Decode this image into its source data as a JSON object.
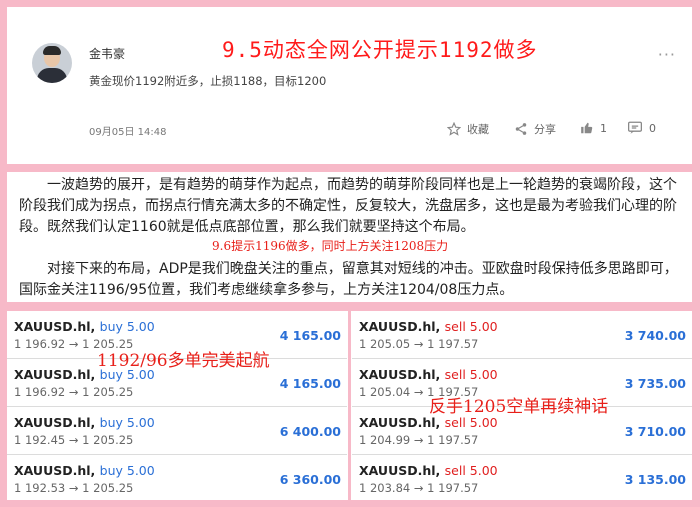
{
  "post": {
    "username": "金韦豪",
    "headline": "9.5动态全网公开提示1192做多",
    "summary": "黄金现价1192附近多，止损1188，目标1200",
    "date": "09月05日 14:48",
    "more": "···",
    "actions": {
      "favorite": "收藏",
      "share": "分享",
      "like_count": "1",
      "comment_count": "0"
    }
  },
  "article": {
    "paragraph1": "一波趋势的展开，是有趋势的萌芽作为起点，而趋势的萌芽阶段同样也是上一轮趋势的衰竭阶段，这个阶段我们成为拐点，而拐点行情充满太多的不确定性，反复较大，洗盘居多，这也是最为考验我们心理的阶段。既然我们认定1160就是低点底部位置，那么我们就要坚持这个布局。",
    "note": "9.6提示1196做多，同时上方关注1208压力",
    "paragraph2": "对接下来的布局，ADP是我们晚盘关注的重点，留意其对短线的冲击。亚欧盘时段保持低多思路即可，国际金关注1196/95位置，我们考虑继续拿多参与，上方关注1204/08压力点。"
  },
  "trades": {
    "left": [
      {
        "symbol": "XAUUSD.hl,",
        "side": "buy 5.00",
        "prices": "1 196.92 → 1 205.25",
        "profit": "4 165.00"
      },
      {
        "symbol": "XAUUSD.hl,",
        "side": "buy 5.00",
        "prices": "1 196.92 → 1 205.25",
        "profit": "4 165.00"
      },
      {
        "symbol": "XAUUSD.hl,",
        "side": "buy 5.00",
        "prices": "1 192.45 → 1 205.25",
        "profit": "6 400.00"
      },
      {
        "symbol": "XAUUSD.hl,",
        "side": "buy 5.00",
        "prices": "1 192.53 → 1 205.25",
        "profit": "6 360.00"
      }
    ],
    "right": [
      {
        "symbol": "XAUUSD.hl,",
        "side": "sell 5.00",
        "prices": "1 205.05 → 1 197.57",
        "profit": "3 740.00"
      },
      {
        "symbol": "XAUUSD.hl,",
        "side": "sell 5.00",
        "prices": "1 205.04 → 1 197.57",
        "profit": "3 735.00"
      },
      {
        "symbol": "XAUUSD.hl,",
        "side": "sell 5.00",
        "prices": "1 204.99 → 1 197.57",
        "profit": "3 710.00"
      },
      {
        "symbol": "XAUUSD.hl,",
        "side": "sell 5.00",
        "prices": "1 203.84 → 1 197.57",
        "profit": "3 135.00"
      }
    ],
    "overlay_left": "1192/96多单完美起航",
    "overlay_right": "反手1205空单再续神话"
  },
  "colors": {
    "background": "#f7b9c8",
    "headline": "#ff1a1a",
    "buy": "#2a6fd6",
    "sell": "#e02020",
    "profit": "#2a6fd6"
  }
}
